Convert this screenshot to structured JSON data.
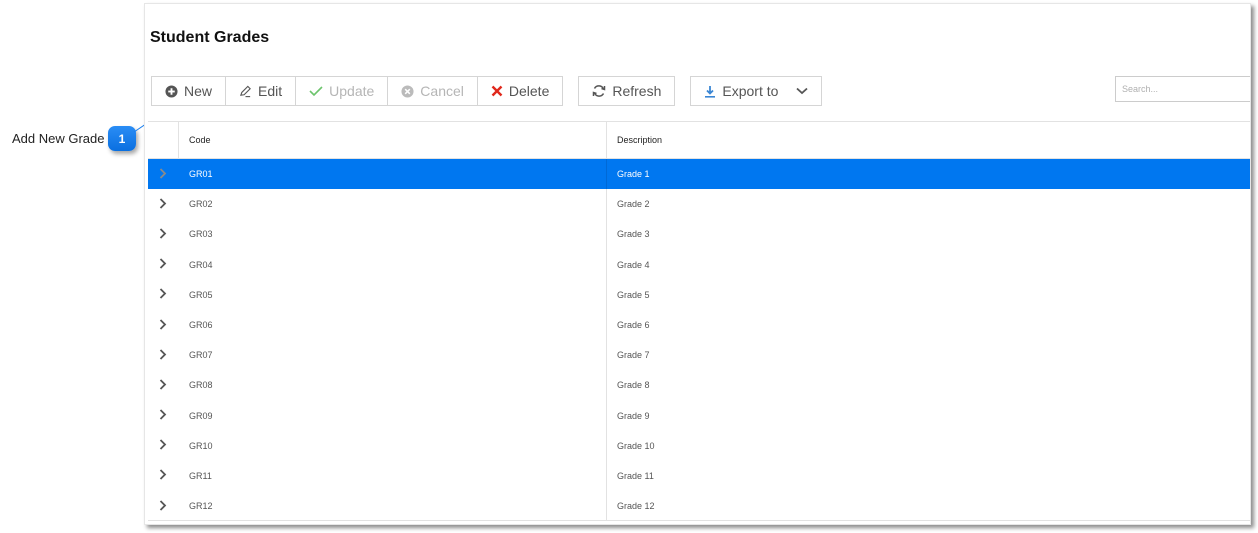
{
  "callout": {
    "label": "Add New Grade",
    "number": "1",
    "color": "#1a7ff0"
  },
  "panel": {
    "title": "Student Grades"
  },
  "toolbar": {
    "new_label": "New",
    "edit_label": "Edit",
    "update_label": "Update",
    "cancel_label": "Cancel",
    "delete_label": "Delete",
    "refresh_label": "Refresh",
    "export_label": "Export to"
  },
  "search": {
    "placeholder": "Search..."
  },
  "grid": {
    "columns": {
      "code": "Code",
      "description": "Description"
    },
    "selected_color": "#0077f0",
    "rows": [
      {
        "code": "GR01",
        "description": "Grade 1",
        "selected": true
      },
      {
        "code": "GR02",
        "description": "Grade 2"
      },
      {
        "code": "GR03",
        "description": "Grade 3"
      },
      {
        "code": "GR04",
        "description": "Grade 4"
      },
      {
        "code": "GR05",
        "description": "Grade 5"
      },
      {
        "code": "GR06",
        "description": "Grade 6"
      },
      {
        "code": "GR07",
        "description": "Grade 7"
      },
      {
        "code": "GR08",
        "description": "Grade 8"
      },
      {
        "code": "GR09",
        "description": "Grade 9"
      },
      {
        "code": "GR10",
        "description": "Grade 10"
      },
      {
        "code": "GR11",
        "description": "Grade 11"
      },
      {
        "code": "GR12",
        "description": "Grade 12"
      }
    ]
  }
}
